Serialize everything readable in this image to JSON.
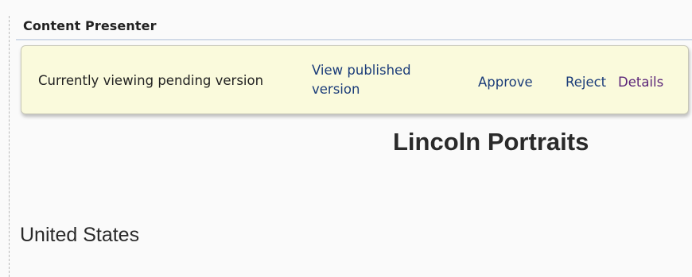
{
  "panel": {
    "title": "Content Presenter"
  },
  "status_bar": {
    "message": "Currently viewing pending version",
    "view_published_line1": "View published",
    "view_published_line2": "version",
    "approve": "Approve",
    "reject": "Reject",
    "details": "Details"
  },
  "content": {
    "heading": "Lincoln Portraits",
    "subheading": "United States"
  },
  "colors": {
    "status_background": "#fafadc",
    "link": "#1c3d7a",
    "visited_link": "#5b2579",
    "text": "#222222"
  }
}
